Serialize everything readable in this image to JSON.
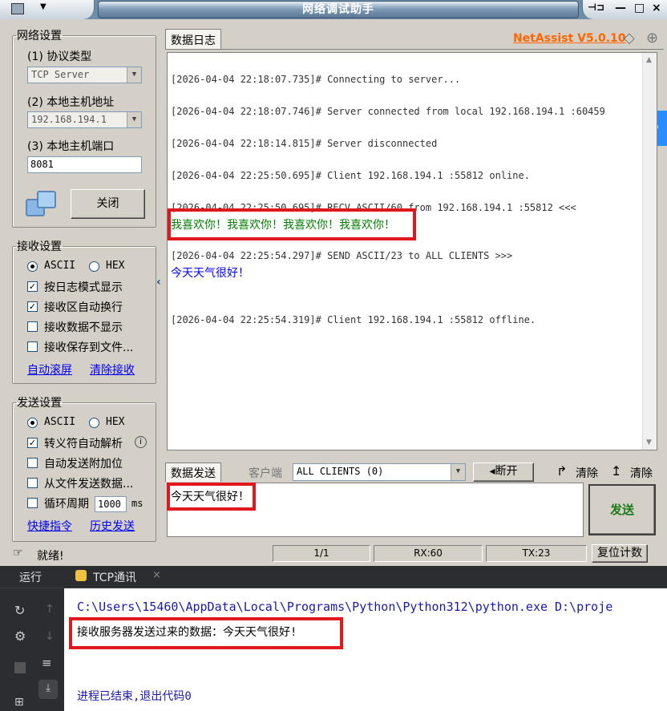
{
  "window": {
    "title": "网络调试助手",
    "brand": "NetAssist V5.0.10",
    "controls": [
      "—",
      "□",
      "×"
    ]
  },
  "network": {
    "legend": "网络设置",
    "protocol_label": "(1) 协议类型",
    "protocol_value": "TCP Server",
    "host_label": "(2) 本地主机地址",
    "host_value": "192.168.194.1",
    "port_label": "(3) 本地主机端口",
    "port_value": "8081",
    "close_button": "关闭"
  },
  "receive": {
    "legend": "接收设置",
    "radio_ascii": "ASCII",
    "radio_hex": "HEX",
    "options": [
      {
        "label": "按日志模式显示",
        "checked": true
      },
      {
        "label": "接收区自动换行",
        "checked": true
      },
      {
        "label": "接收数据不显示",
        "checked": false
      },
      {
        "label": "接收保存到文件...",
        "checked": false
      }
    ],
    "link_autoscroll": "自动滚屏",
    "link_clear": "清除接收"
  },
  "send": {
    "legend": "发送设置",
    "radio_ascii": "ASCII",
    "radio_hex": "HEX",
    "options": [
      {
        "label": "转义符自动解析",
        "checked": true
      },
      {
        "label": "自动发送附加位",
        "checked": false
      },
      {
        "label": "从文件发送数据...",
        "checked": false
      }
    ],
    "loop_label": "循环周期",
    "loop_value": "1000",
    "loop_unit": "ms",
    "link_shortcut": "快捷指令",
    "link_history": "历史发送"
  },
  "log": {
    "tab": "数据日志",
    "entries": [
      "[2026-04-04 22:18:07.735]# Connecting to server...",
      "[2026-04-04 22:18:07.746]# Server connected from local 192.168.194.1 :60459",
      "[2026-04-04 22:18:14.815]# Server disconnected",
      "[2026-04-04 22:25:50.695]# Client 192.168.194.1 :55812 online.",
      "[2026-04-04 22:25:50.695]# RECV ASCII/60 from 192.168.194.1 :55812 <<<",
      "[2026-04-04 22:25:54.297]# SEND ASCII/23 to ALL CLIENTS >>>",
      "[2026-04-04 22:25:54.319]# Client 192.168.194.1 :55812 offline."
    ],
    "recv_text": "我喜欢你！我喜欢你！我喜欢你！我喜欢你！",
    "send_text": "今天天气很好！"
  },
  "sendbar": {
    "tab": "数据发送",
    "client_label": "客户端",
    "client_value": "ALL CLIENTS (0)",
    "disconnect": "断开",
    "clear1": "清除",
    "clear2": "清除",
    "input_text": "今天天气很好！",
    "send_button": "发送"
  },
  "status": {
    "ready": "就绪!",
    "page": "1/1",
    "rx": "RX:60",
    "tx": "TX:23",
    "reset": "复位计数"
  },
  "ide": {
    "run_tab": "运行",
    "file_tab": "TCP通讯",
    "cmd": "C:\\Users\\15460\\AppData\\Local\\Programs\\Python\\Python312\\python.exe D:\\proje",
    "output": "接收服务器发送过来的数据：今天天气很好!",
    "exit": "进程已结束,退出代码0"
  },
  "colors": {
    "highlight_box": "#e0181e",
    "recv_green": "#008000",
    "send_blue": "#0000ff",
    "brand_orange": "#ff6600"
  }
}
